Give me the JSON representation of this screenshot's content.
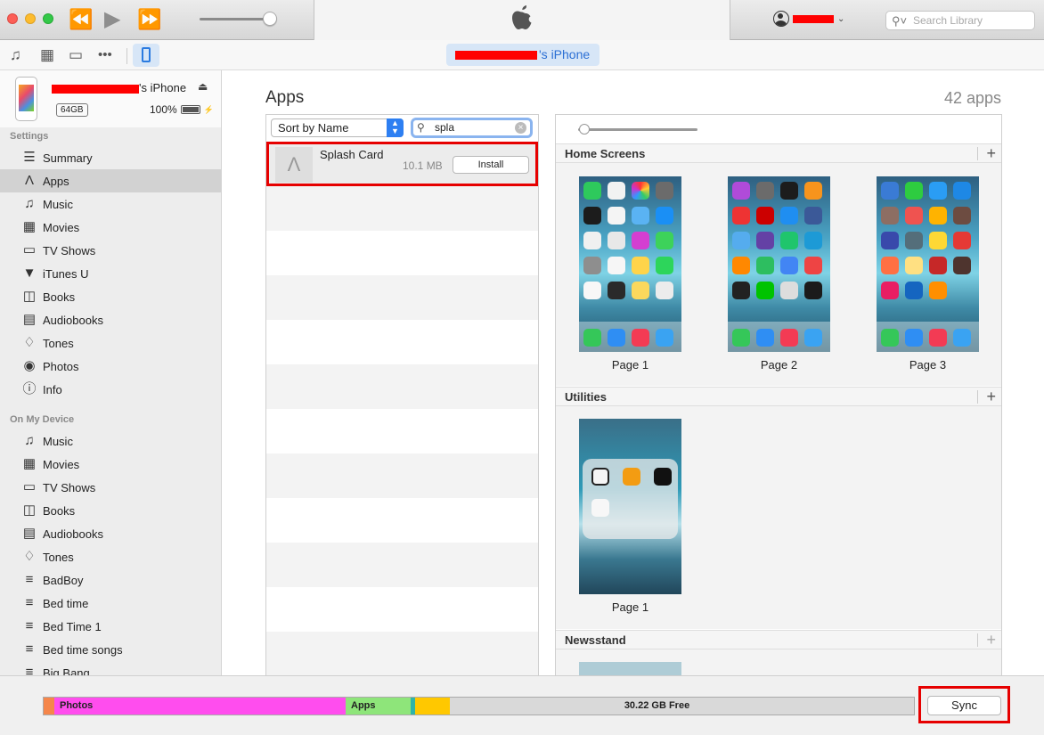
{
  "toolbar": {
    "search_placeholder": "Search Library"
  },
  "mediabar": {
    "device_suffix": "'s iPhone"
  },
  "device": {
    "name_suffix": "'s iPhone",
    "capacity": "64GB",
    "battery": "100%"
  },
  "sidebar": {
    "settings_header": "Settings",
    "settings_items": [
      {
        "label": "Summary",
        "icon": "summary-icon"
      },
      {
        "label": "Apps",
        "icon": "apps-icon",
        "selected": true
      },
      {
        "label": "Music",
        "icon": "music-icon"
      },
      {
        "label": "Movies",
        "icon": "movies-icon"
      },
      {
        "label": "TV Shows",
        "icon": "tv-icon"
      },
      {
        "label": "iTunes U",
        "icon": "itunes-u-icon"
      },
      {
        "label": "Books",
        "icon": "books-icon"
      },
      {
        "label": "Audiobooks",
        "icon": "audiobooks-icon"
      },
      {
        "label": "Tones",
        "icon": "tones-icon"
      },
      {
        "label": "Photos",
        "icon": "photos-icon"
      },
      {
        "label": "Info",
        "icon": "info-icon"
      }
    ],
    "device_header": "On My Device",
    "device_items": [
      {
        "label": "Music",
        "icon": "music-icon"
      },
      {
        "label": "Movies",
        "icon": "movies-icon"
      },
      {
        "label": "TV Shows",
        "icon": "tv-icon"
      },
      {
        "label": "Books",
        "icon": "books-icon"
      },
      {
        "label": "Audiobooks",
        "icon": "audiobooks-icon"
      },
      {
        "label": "Tones",
        "icon": "tones-icon"
      },
      {
        "label": "BadBoy",
        "icon": "playlist-icon"
      },
      {
        "label": "Bed time",
        "icon": "playlist-icon"
      },
      {
        "label": "Bed Time 1",
        "icon": "playlist-icon"
      },
      {
        "label": "Bed time songs",
        "icon": "playlist-icon"
      },
      {
        "label": "Big Bang",
        "icon": "playlist-icon"
      }
    ]
  },
  "main": {
    "title": "Apps",
    "count": "42 apps",
    "sort_label": "Sort by Name",
    "search_value": "spla",
    "result": {
      "name": "Splash Card",
      "size": "10.1 MB",
      "button": "Install"
    },
    "home_screens_title": "Home Screens",
    "pages": [
      "Page 1",
      "Page 2",
      "Page 3"
    ],
    "utilities_title": "Utilities",
    "utilities_page": "Page 1",
    "newsstand_title": "Newsstand"
  },
  "capacity": {
    "segments": [
      {
        "label": "",
        "color": "#f5864a",
        "fraction": 0.012
      },
      {
        "label": "Photos",
        "color": "#ff4dee",
        "fraction": 0.335
      },
      {
        "label": "Apps",
        "color": "#8ee57a",
        "fraction": 0.075
      },
      {
        "label": "",
        "color": "#2fb4a8",
        "fraction": 0.005
      },
      {
        "label": "",
        "color": "#ffc800",
        "fraction": 0.04
      }
    ],
    "free_label": "30.22 GB Free"
  },
  "sync_button": "Sync"
}
